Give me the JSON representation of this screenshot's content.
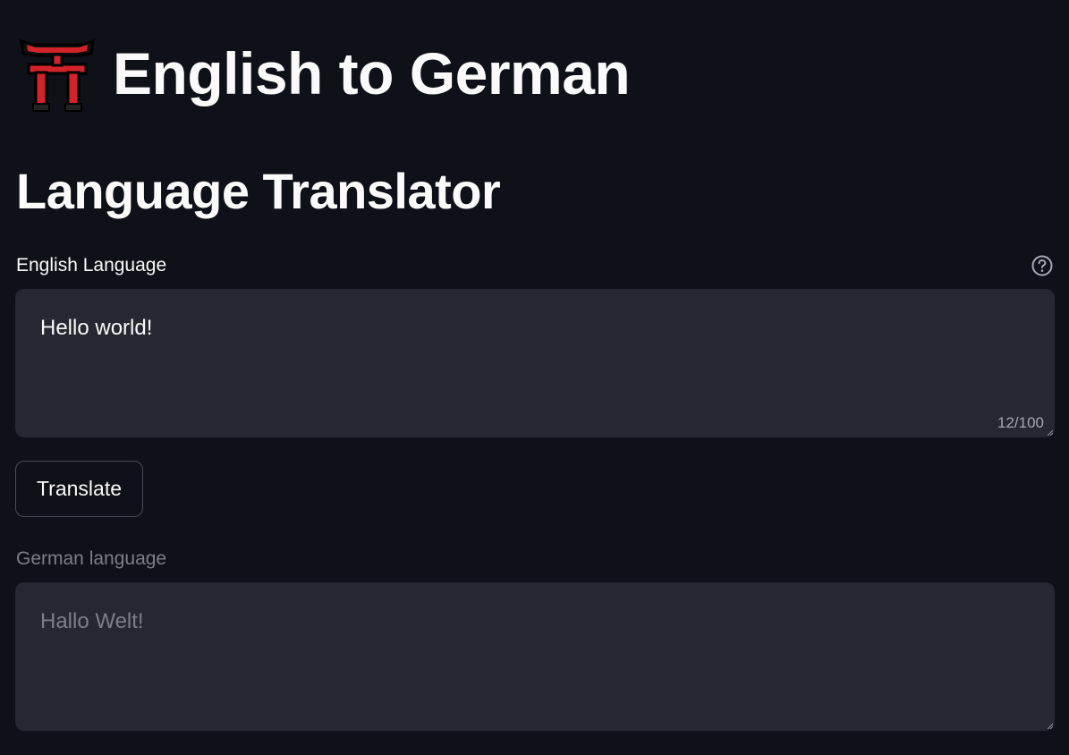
{
  "app": {
    "title": "English to German",
    "icon": "torii-gate-icon"
  },
  "main": {
    "subtitle": "Language Translator"
  },
  "input": {
    "label": "English Language",
    "value": "Hello world!",
    "counter": "12/100",
    "help_icon": "question-circle-icon"
  },
  "actions": {
    "translate_label": "Translate"
  },
  "output": {
    "label": "German language",
    "value": "Hallo Welt!"
  },
  "colors": {
    "background": "#0f1118",
    "field_background": "#262730",
    "text": "#fafafa",
    "muted_text": "#7d7f86",
    "torii_red": "#d2232a"
  }
}
